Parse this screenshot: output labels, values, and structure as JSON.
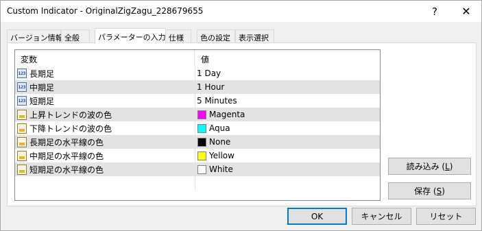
{
  "window": {
    "title": "Custom Indicator - OriginalZigZagu_228679655",
    "help_glyph": "?",
    "close_glyph": "✕"
  },
  "tabs": [
    {
      "label": "バージョン情報",
      "active": false
    },
    {
      "label": "全般",
      "active": false
    },
    {
      "label": "パラメーターの入力",
      "active": true
    },
    {
      "label": "仕様",
      "active": false
    },
    {
      "label": "色の設定",
      "active": false
    },
    {
      "label": "表示選択",
      "active": false
    }
  ],
  "grid": {
    "columns": [
      "変数",
      "値"
    ],
    "rows": [
      {
        "name": "長期足",
        "value": "1 Day",
        "icon": "number-param-icon",
        "icon_text": "123"
      },
      {
        "name": "中期足",
        "value": "1 Hour",
        "icon": "number-param-icon",
        "icon_text": "123"
      },
      {
        "name": "短期足",
        "value": "5 Minutes",
        "icon": "number-param-icon",
        "icon_text": "123"
      },
      {
        "name": "上昇トレンドの波の色",
        "value": "Magenta",
        "icon": "color-param-icon",
        "swatch": "#ff00ff"
      },
      {
        "name": "下降トレンドの波の色",
        "value": "Aqua",
        "icon": "color-param-icon",
        "swatch": "#00ffff"
      },
      {
        "name": "長期足の水平線の色",
        "value": "None",
        "icon": "color-param-icon",
        "swatch": "#000000"
      },
      {
        "name": "中期足の水平線の色",
        "value": "Yellow",
        "icon": "color-param-icon",
        "swatch": "#ffff00"
      },
      {
        "name": "短期足の水平線の色",
        "value": "White",
        "icon": "color-param-icon",
        "swatch": "#ffffff"
      }
    ]
  },
  "side_buttons": {
    "load": {
      "label": "読み込み (",
      "key": "L",
      "end": ")"
    },
    "save": {
      "label": "保存 (",
      "key": "S",
      "end": ")"
    }
  },
  "footer_buttons": {
    "ok": "OK",
    "cancel": "キャンセル",
    "reset": "リセット"
  },
  "colors": {
    "selected_row_shade": "#e3e3e3",
    "default_button_border": "#0078d7"
  }
}
